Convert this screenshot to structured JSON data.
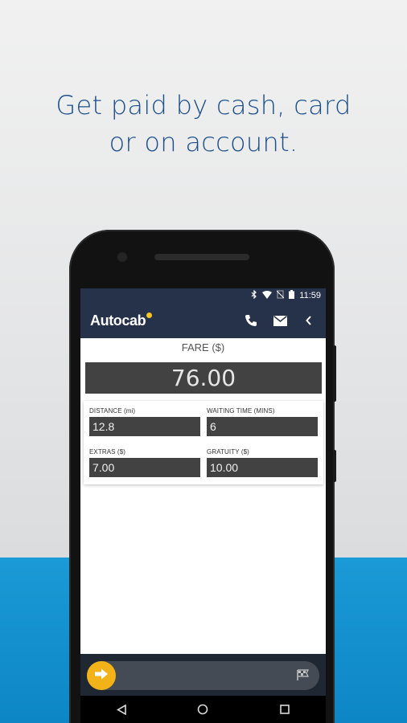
{
  "headline": {
    "line1": "Get paid by cash, card",
    "line2": "or on account."
  },
  "status_bar": {
    "time": "11:59",
    "icons": [
      "bluetooth-icon",
      "wifi-icon",
      "no-sim-icon",
      "battery-icon"
    ]
  },
  "app_bar": {
    "logo": "Autocab",
    "actions": [
      "phone-icon",
      "mail-icon",
      "back-chevron-icon"
    ]
  },
  "fare": {
    "label": "FARE ($)",
    "value": "76.00"
  },
  "fields": [
    {
      "label": "DISTANCE (mi)",
      "value": "12.8"
    },
    {
      "label": "WAITING TIME (MINS)",
      "value": "6"
    },
    {
      "label": "EXTRAS ($)",
      "value": "7.00"
    },
    {
      "label": "GRATUITY ($)",
      "value": "10.00"
    }
  ],
  "slider": {
    "knob_icon": "arrow-right-icon",
    "end_icon": "checkered-flag-icon"
  },
  "nav_bar": [
    "back-triangle-icon",
    "home-circle-icon",
    "recents-square-icon"
  ],
  "colors": {
    "app_bar": "#26314a",
    "accent": "#f2b218",
    "headline": "#1b4f8c",
    "bottom_band": "#1a9ad6"
  }
}
